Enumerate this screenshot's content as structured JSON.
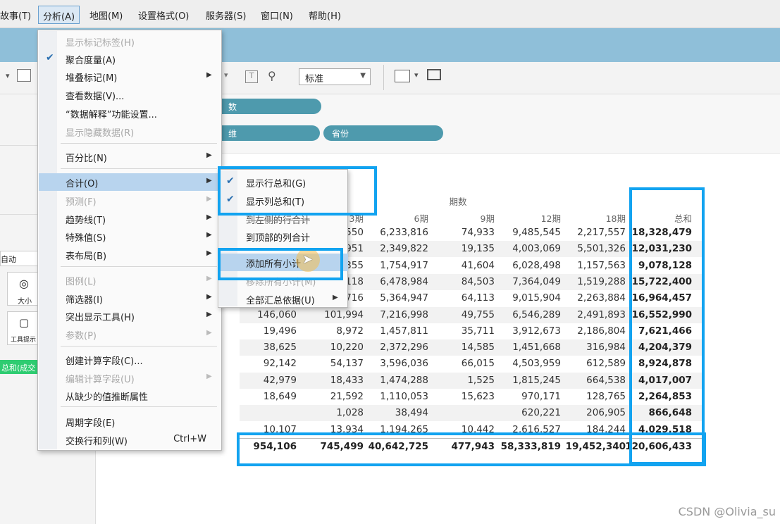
{
  "menubar": {
    "items": [
      "故事(T)",
      "分析(A)",
      "地图(M)",
      "设置格式(O)",
      "服务器(S)",
      "窗口(N)",
      "帮助(H)"
    ]
  },
  "toolbar": {
    "mark_type": "标准"
  },
  "shelves": {
    "pill1": "数",
    "pill2": "维",
    "pill3": "省份"
  },
  "left_panel": {
    "auto_label": "自动",
    "size_label": "大小",
    "tooltip_label": "工具提示",
    "green_pill": "总和(成交"
  },
  "analysis_menu": {
    "items": [
      {
        "label": "显示标记标签(H)",
        "disabled": true
      },
      {
        "label": "聚合度量(A)",
        "checked": true
      },
      {
        "label": "堆叠标记(M)",
        "submenu": true
      },
      {
        "label": "查看数据(V)..."
      },
      {
        "label": "“数据解释”功能设置..."
      },
      {
        "label": "显示隐藏数据(R)",
        "disabled": true
      },
      {
        "label": "百分比(N)",
        "submenu": true
      },
      {
        "label": "合计(O)",
        "submenu": true,
        "highlighted": true
      },
      {
        "label": "预测(F)",
        "submenu": true,
        "disabled": true
      },
      {
        "label": "趋势线(T)",
        "submenu": true
      },
      {
        "label": "特殊值(S)",
        "submenu": true
      },
      {
        "label": "表布局(B)",
        "submenu": true
      },
      {
        "label": "图例(L)",
        "submenu": true,
        "disabled": true
      },
      {
        "label": "筛选器(I)",
        "submenu": true
      },
      {
        "label": "突出显示工具(H)",
        "submenu": true
      },
      {
        "label": "参数(P)",
        "submenu": true,
        "disabled": true
      },
      {
        "label": "创建计算字段(C)..."
      },
      {
        "label": "编辑计算字段(U)",
        "submenu": true,
        "disabled": true
      },
      {
        "label": "从缺少的值推断属性"
      },
      {
        "label": "周期字段(E)"
      },
      {
        "label": "交换行和列(W)",
        "shortcut": "Ctrl+W"
      }
    ]
  },
  "totals_submenu": {
    "items": [
      {
        "label": "显示行总和(G)",
        "checked": true
      },
      {
        "label": "显示列总和(T)",
        "checked": true
      },
      {
        "label": "到左侧的行合计",
        "partial": true
      },
      {
        "label": "到顶部的列合计"
      },
      {
        "label": "添加所有小计",
        "highlighted": true
      },
      {
        "label": "移除所有小计(M)",
        "disabled": true
      },
      {
        "label": "全部汇总依据(U)",
        "submenu": true
      }
    ]
  },
  "table": {
    "group_header": "期数",
    "columns": [
      "3期",
      "6期",
      "9期",
      "12期",
      "18期",
      "总和"
    ],
    "rows": [
      [
        "",
        "550",
        "6,233,816",
        "74,933",
        "9,485,545",
        "2,217,557",
        "18,328,479"
      ],
      [
        "",
        "951",
        "2,349,822",
        "19,135",
        "4,003,069",
        "5,501,326",
        "12,031,230"
      ],
      [
        "",
        "355",
        "1,754,917",
        "41,604",
        "6,028,498",
        "1,157,563",
        "9,078,128"
      ],
      [
        "",
        "118",
        "6,478,984",
        "84,503",
        "7,364,049",
        "1,519,288",
        "15,722,400"
      ],
      [
        "",
        "716",
        "5,364,947",
        "64,113",
        "9,015,904",
        "2,263,884",
        "16,964,457"
      ],
      [
        "146,060",
        "101,994",
        "7,216,998",
        "49,755",
        "6,546,289",
        "2,491,893",
        "16,552,990"
      ],
      [
        "19,496",
        "8,972",
        "1,457,811",
        "35,711",
        "3,912,673",
        "2,186,804",
        "7,621,466"
      ],
      [
        "38,625",
        "10,220",
        "2,372,296",
        "14,585",
        "1,451,668",
        "316,984",
        "4,204,379"
      ],
      [
        "92,142",
        "54,137",
        "3,596,036",
        "66,015",
        "4,503,959",
        "612,589",
        "8,924,878"
      ],
      [
        "42,979",
        "18,433",
        "1,474,288",
        "1,525",
        "1,815,245",
        "664,538",
        "4,017,007"
      ],
      [
        "18,649",
        "21,592",
        "1,110,053",
        "15,623",
        "970,171",
        "128,765",
        "2,264,853"
      ],
      [
        "",
        "1,028",
        "38,494",
        "",
        "620,221",
        "206,905",
        "866,648"
      ],
      [
        "10,107",
        "13,934",
        "1,194,265",
        "10,442",
        "2,616,527",
        "184,244",
        "4,029,518"
      ]
    ],
    "total_row": [
      "954,106",
      "745,499",
      "40,642,725",
      "477,943",
      "58,333,819",
      "19,452,340",
      "120,606,433"
    ]
  },
  "watermark": "CSDN @Olivia_su",
  "colors": {
    "highlight_box": "#12a3f0",
    "pill": "#4e9aad"
  }
}
